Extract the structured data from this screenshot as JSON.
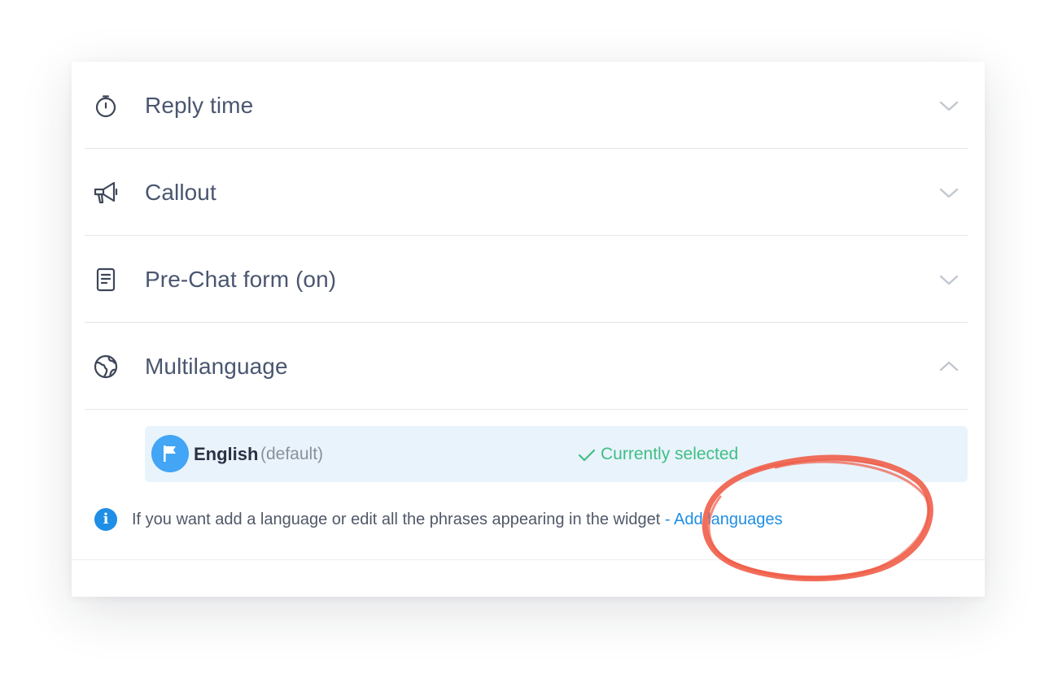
{
  "sections": [
    {
      "title": "Reply time",
      "icon": "stopwatch-icon",
      "expanded": false
    },
    {
      "title": "Callout",
      "icon": "megaphone-icon",
      "expanded": false
    },
    {
      "title": "Pre-Chat form (on)",
      "icon": "form-icon",
      "expanded": false
    },
    {
      "title": "Multilanguage",
      "icon": "globe-icon",
      "expanded": true
    }
  ],
  "multilanguage": {
    "language": {
      "name": "English",
      "suffix": "(default)",
      "status": "Currently selected",
      "flag_icon": "flag-icon",
      "check_icon": "checkmark-icon"
    },
    "info": {
      "text": "If you want add a language or edit all the phrases appearing in the widget",
      "link": "- Add languages",
      "icon": "info-icon",
      "icon_glyph": "i"
    }
  },
  "colors": {
    "accent": "#1e8ee6",
    "success": "#3fbf84",
    "selected_bg": "#e9f3fc",
    "annotation": "#ef5a44"
  }
}
